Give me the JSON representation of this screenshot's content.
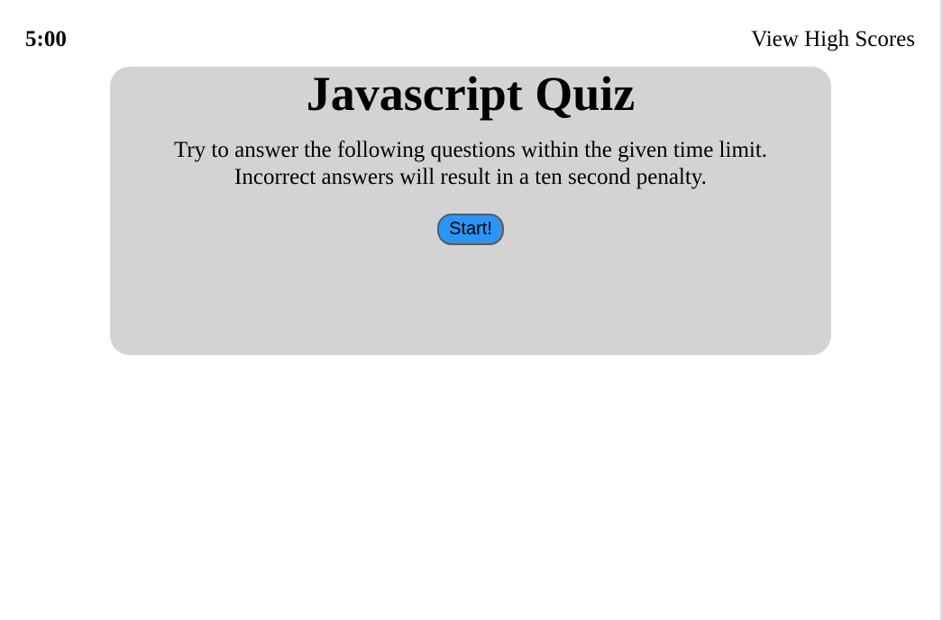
{
  "header": {
    "timer": "5:00",
    "high_scores_link": "View High Scores"
  },
  "quiz": {
    "title": "Javascript Quiz",
    "description_line_1": "Try to answer the following questions within the given time limit.",
    "description_line_2": "Incorrect answers will result in a ten second penalty.",
    "start_label": "Start!"
  },
  "colors": {
    "card_background": "#d3d3d3",
    "start_button": "#2b95f7"
  }
}
